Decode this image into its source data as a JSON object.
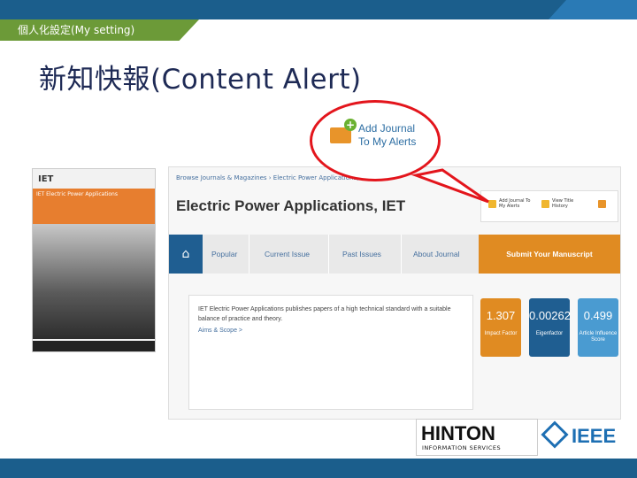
{
  "header": {
    "tag_label": "個人化設定(My setting)",
    "slide_title": "新知快報(Content Alert)"
  },
  "callout": {
    "line1": "Add Journal",
    "line2": "To My Alerts"
  },
  "journal": {
    "cover_brand": "IET",
    "cover_title": "IET Electric Power Applications",
    "breadcrumb": "Browse Journals & Magazines ›  Electric Power Applications, I",
    "title": "Electric Power Applications, IET",
    "tools": {
      "add_alert": "Add Journal To My Alerts",
      "view_title_history": "View Title History"
    },
    "nav": {
      "home": "⌂",
      "popular": "Popular",
      "current_issue": "Current Issue",
      "past_issues": "Past Issues",
      "about": "About Journal",
      "submit": "Submit Your Manuscript"
    },
    "description": "IET Electric Power Applications publishes papers of a high technical standard with a suitable balance of practice and theory.",
    "aims_link": "Aims & Scope >",
    "metrics": [
      {
        "value": "1.307",
        "label": "Impact Factor",
        "color": "#e08b22"
      },
      {
        "value": "0.00262",
        "label": "Eigenfactor",
        "color": "#1f5e91"
      },
      {
        "value": "0.499",
        "label": "Article Influence Score",
        "color": "#4a9bd1"
      }
    ]
  },
  "logos": {
    "hinton": "HINTON",
    "hinton_sub": "INFORMATION SERVICES",
    "ieee": "IEEE"
  }
}
